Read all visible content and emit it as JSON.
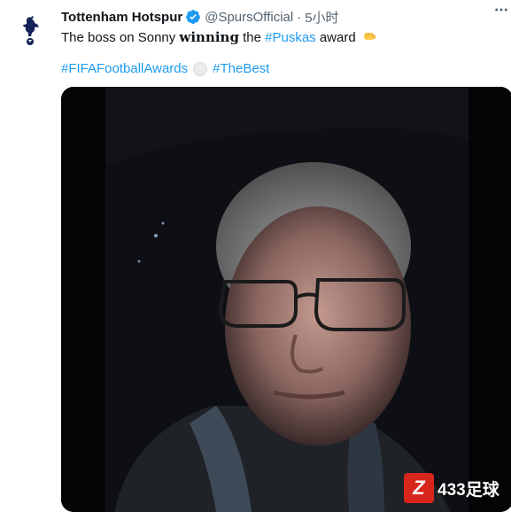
{
  "tweet": {
    "display_name": "Tottenham Hotspur",
    "handle": "@SpursOfficial",
    "separator": "·",
    "time": "5小时",
    "text_before": "The boss on Sonny ",
    "text_bold": "winning",
    "text_mid": " the ",
    "hashtag_puskas": "#Puskas",
    "text_after": " award",
    "hashtag_fifa": "#FIFAFootballAwards",
    "hashtag_best": "#TheBest"
  },
  "icons": {
    "avatar": "spurs-cockerel-logo",
    "verified": "verified-badge-icon",
    "more": "more-horizontal-icon",
    "fist": "oncoming-fist-emoji",
    "ball": "soccer-ball-emoji"
  },
  "colors": {
    "link": "#1d9bf0",
    "verified": "#1d9bf0",
    "secondary_text": "#536471",
    "primary_text": "#0f1419"
  },
  "watermark": {
    "badge": "Z",
    "text": "433足球"
  }
}
